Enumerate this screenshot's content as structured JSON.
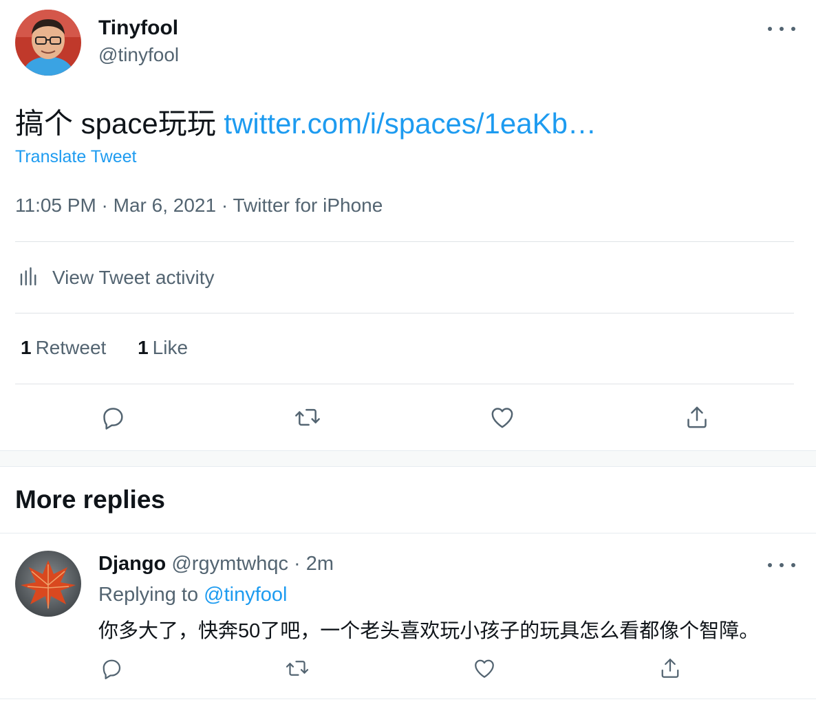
{
  "tweet": {
    "author_name": "Tinyfool",
    "author_handle": "@tinyfool",
    "text": "搞个 space玩玩 ",
    "link_text": "twitter.com/i/spaces/1eaKb…",
    "translate_label": "Translate Tweet",
    "meta": "11:05 PM · Mar 6, 2021 · Twitter for iPhone",
    "activity_label": "View Tweet activity",
    "retweet_count": "1",
    "retweet_label": "Retweet",
    "like_count": "1",
    "like_label": "Like",
    "more_icon": "more-horizontal-icon"
  },
  "actions": [
    "reply-icon",
    "retweet-icon",
    "like-icon",
    "share-icon"
  ],
  "section_title": "More replies",
  "reply": {
    "name": "Django",
    "handle": "@rgymtwhqc",
    "separator": "·",
    "time": "2m",
    "replying_prefix": "Replying to ",
    "replying_to": "@tinyfool",
    "text": "你多大了，快奔50了吧，一个老头喜欢玩小孩子的玩具怎么看都像个智障。"
  },
  "colors": {
    "accent": "#1d9bf0",
    "secondary_text": "#536471",
    "primary_text": "#0f1419",
    "divider": "#dfe3e6"
  }
}
